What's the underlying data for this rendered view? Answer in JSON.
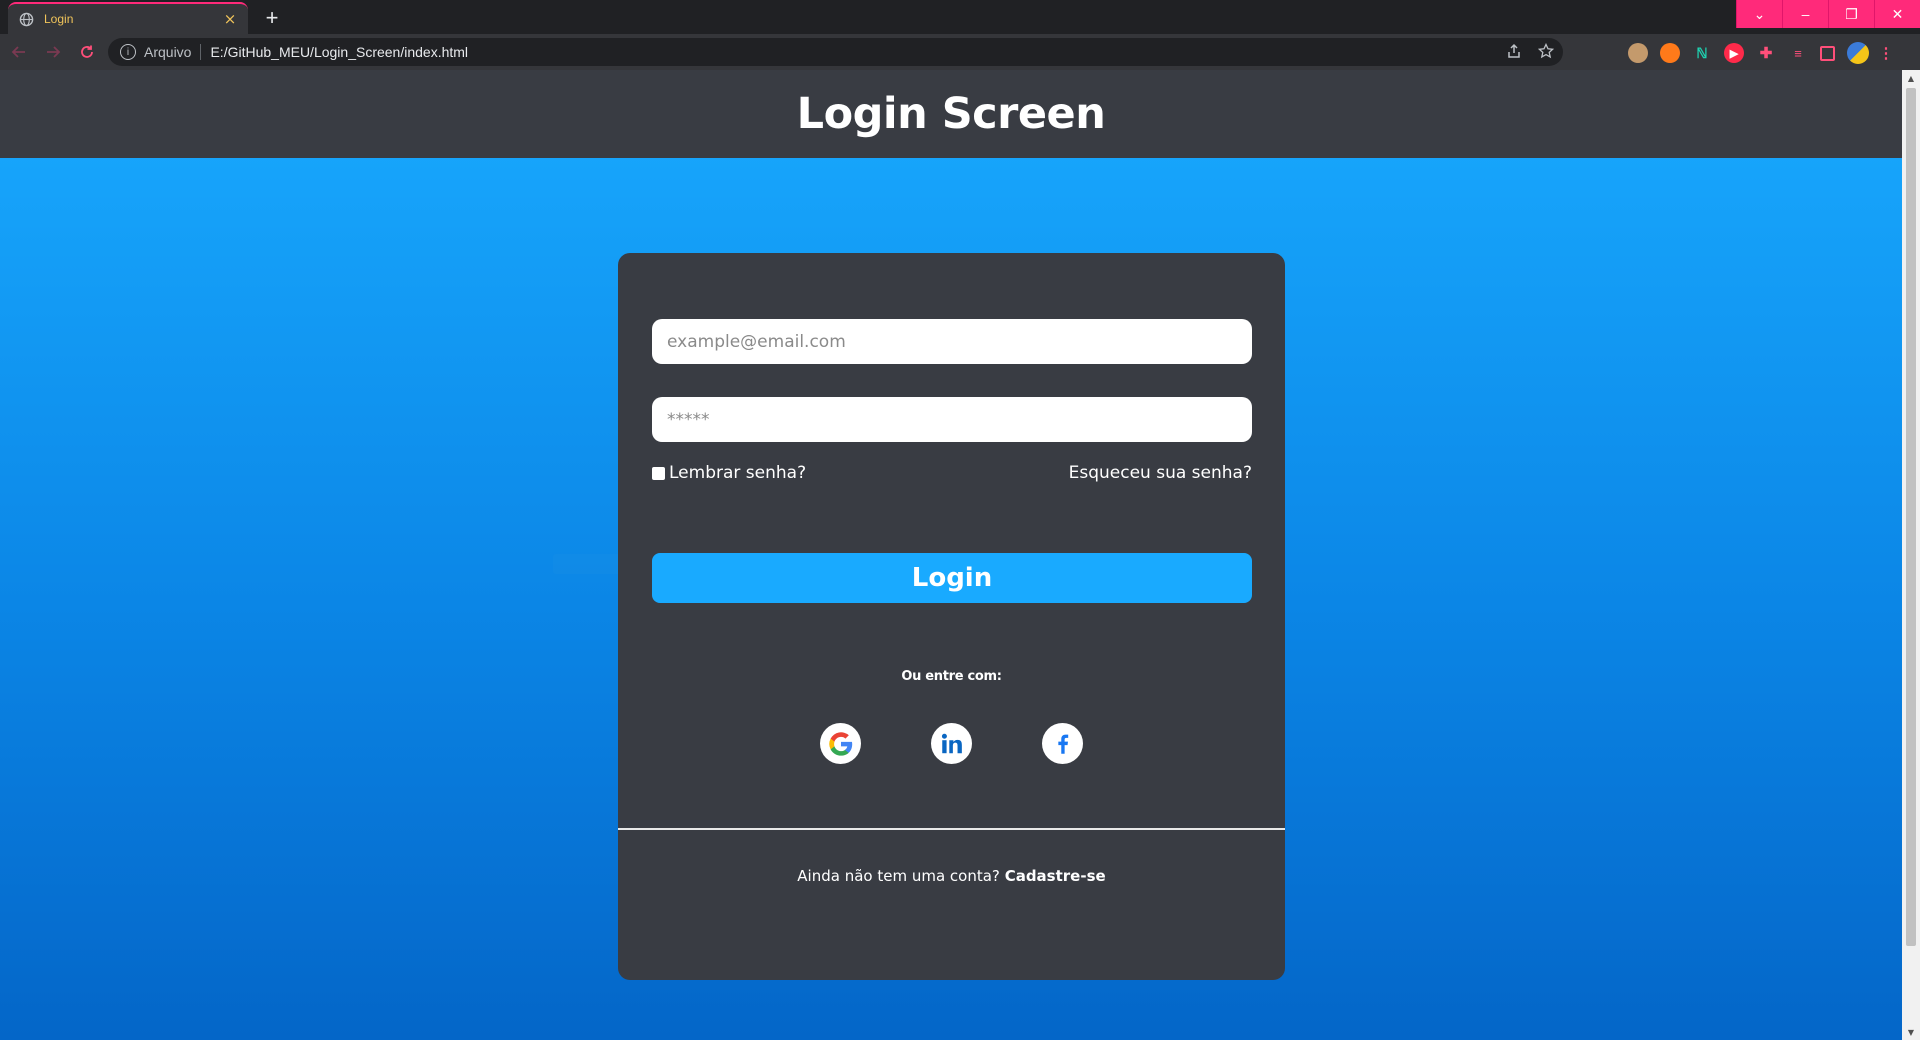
{
  "browser": {
    "tab_title": "Login",
    "tab_close": "×",
    "new_tab": "+",
    "url_scheme": "Arquivo",
    "url": "E:/GitHub_MEU/Login_Screen/index.html",
    "window_buttons": [
      "⌄",
      "–",
      "❐",
      "✕"
    ]
  },
  "page": {
    "title": "Login Screen"
  },
  "form": {
    "email_placeholder": "example@email.com",
    "password_placeholder": "*****",
    "remember_label": "Lembrar senha?",
    "forgot_label": "Esqueceu sua senha?",
    "login_button": "Login",
    "or_label": "Ou entre com:",
    "signup_prompt": "Ainda não tem uma conta?",
    "signup_link": "Cadastre-se"
  },
  "colors": {
    "accent": "#19aaff",
    "card": "#393c43",
    "chrome_accent": "#ff2a7a"
  },
  "icons": {
    "social": [
      "google-icon",
      "linkedin-icon",
      "facebook-icon"
    ]
  }
}
